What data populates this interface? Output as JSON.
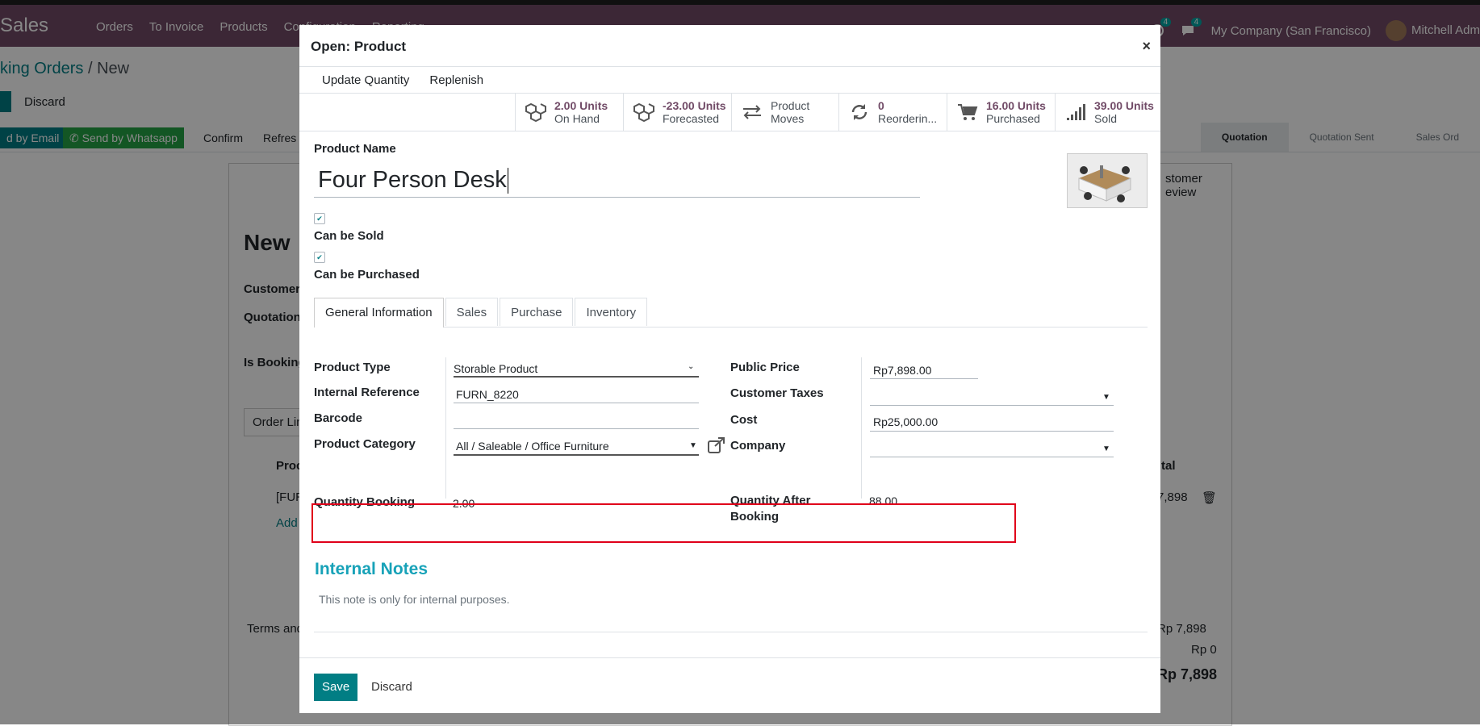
{
  "app": {
    "brand": "Sales",
    "menu": [
      "Orders",
      "To Invoice",
      "Products",
      "Configuration",
      "Reporting"
    ],
    "activity_count": "4",
    "message_count": "4",
    "company": "My Company (San Francisco)",
    "user": "Mitchell Adm"
  },
  "breadcrumb": {
    "parent": "king Orders",
    "separator": "/",
    "current": "New"
  },
  "bg_buttons": {
    "discard": "Discard"
  },
  "bg_status": {
    "send_email": "d by Email",
    "send_whatsapp": "Send by Whatsapp",
    "confirm": "Confirm",
    "refresh": "Refres",
    "stages": [
      "Quotation",
      "Quotation Sent",
      "Sales Ord"
    ]
  },
  "bg_sheet": {
    "title": "New",
    "customer": "Customer",
    "quotation": "Quotation",
    "is_booking": "Is Booking",
    "order_lines_tab": "Order Lin",
    "product_col": "Proc",
    "total_col": "tal",
    "line_code": "[FUR",
    "line_amount": "7,898",
    "add_line": "Add",
    "terms": "Terms and",
    "customer_preview": "stomer\neview",
    "untaxed": "Rp 7,898",
    "taxes": "Rp 0",
    "total": "Rp 7,898"
  },
  "modal": {
    "title": "Open: Product",
    "close": "×",
    "actions": [
      "Update Quantity",
      "Replenish"
    ],
    "smart_buttons": [
      {
        "value": "2.00 Units",
        "label": "On Hand",
        "icon": "cubes-icon"
      },
      {
        "value": "-23.00 Units",
        "label": "Forecasted",
        "icon": "cubes-icon"
      },
      {
        "value": "Product",
        "label": "Moves",
        "icon": "exchange-icon",
        "plain": true
      },
      {
        "value": "0",
        "label": "Reorderin...",
        "icon": "refresh-icon"
      },
      {
        "value": "16.00 Units",
        "label": "Purchased",
        "icon": "cart-icon"
      },
      {
        "value": "39.00 Units",
        "label": "Sold",
        "icon": "signal-icon"
      }
    ],
    "product_name_label": "Product Name",
    "product_name": "Four Person Desk",
    "can_be_sold_label": "Can be Sold",
    "can_be_sold": true,
    "can_be_purchased_label": "Can be Purchased",
    "can_be_purchased": true,
    "tabs": [
      "General Information",
      "Sales",
      "Purchase",
      "Inventory"
    ],
    "active_tab": "General Information",
    "left_fields": {
      "product_type_label": "Product Type",
      "product_type": "Storable Product",
      "internal_ref_label": "Internal Reference",
      "internal_ref": "FURN_8220",
      "barcode_label": "Barcode",
      "barcode": "",
      "category_label": "Product Category",
      "category": "All / Saleable / Office Furniture",
      "qty_booking_label": "Quantity Booking",
      "qty_booking": "2.00"
    },
    "right_fields": {
      "public_price_label": "Public Price",
      "public_price": "Rp7,898.00",
      "customer_taxes_label": "Customer Taxes",
      "customer_taxes": "",
      "cost_label": "Cost",
      "cost": "Rp25,000.00",
      "company_label": "Company",
      "company": "",
      "qty_after_label_1": "Quantity After",
      "qty_after_label_2": "Booking",
      "qty_after": "88.00"
    },
    "notes_title": "Internal Notes",
    "notes_placeholder": "This note is only for internal purposes.",
    "footer": {
      "save": "Save",
      "discard": "Discard"
    }
  },
  "colors": {
    "navbar": "#714b67",
    "primary": "#017e84",
    "whatsapp": "#25a244",
    "highlight": "#e0001a",
    "notes_title": "#17a2b8"
  }
}
